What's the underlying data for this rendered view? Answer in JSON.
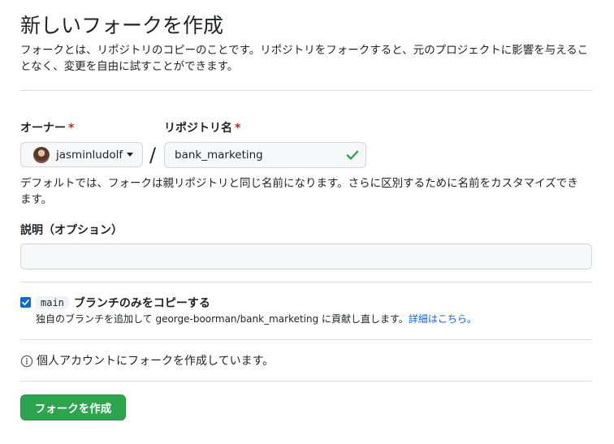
{
  "page": {
    "title": "新しいフォークを作成",
    "subtitle": "フォークとは、リポジトリのコピーのことです。リポジトリをフォークすると、元のプロジェクトに影響を与えることなく、変更を自由に試すことができます。"
  },
  "owner": {
    "label": "オーナー",
    "required_mark": "*",
    "name": "jasminludolf",
    "avatar_icon": "user-avatar"
  },
  "repo": {
    "separator": "/",
    "label": "リポジトリ名",
    "required_mark": "*",
    "value": "bank_marketing",
    "status_icon": "check-icon",
    "help": "デフォルトでは、フォークは親リポジトリと同じ名前になります。さらに区別するために名前をカスタマイズできます。"
  },
  "description": {
    "label": "説明（オプション）",
    "value": ""
  },
  "copy_branch": {
    "checked": true,
    "branch": "main",
    "label": "ブランチのみをコピーする",
    "help_text": "独自のブランチを追加して george-boorman/bank_marketing に貢献し直します。",
    "learn_more": "詳細はこちら。"
  },
  "info": {
    "icon": "info-icon",
    "text": "個人アカウントにフォークを作成しています。"
  },
  "submit": {
    "label": "フォークを作成"
  },
  "colors": {
    "primary_button": "#2da44e",
    "link": "#0969da",
    "required": "#cf222e",
    "success": "#2da44e",
    "checkbox": "#0969da"
  }
}
